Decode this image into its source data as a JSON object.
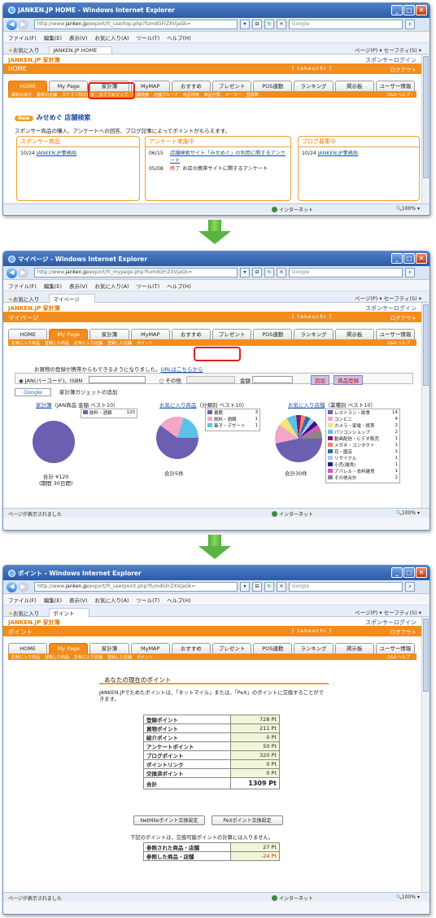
{
  "browser": {
    "app_suffix": " - Windows Internet Explorer",
    "menu": [
      "ファイル(F)",
      "編集(E)",
      "表示(V)",
      "お気に入り(A)",
      "ツール(T)",
      "ヘルプ(H)"
    ],
    "favorites_label": "お気に入り",
    "commands": "ページ(P) ▾  セーフティ(S) ▾",
    "search_placeholder": "Google",
    "status_zone": "インターネット",
    "zoom": "100%"
  },
  "site": {
    "name": "JANKEN.JP 家計簿",
    "sponsor_login": "スポンサーログイン",
    "user": "[ takeuchi ]",
    "logout": "ログアウト"
  },
  "nav": [
    "HOME",
    "My Page",
    "家計簿",
    "MyMAP",
    "おすすめ",
    "プレゼント",
    "POS連動",
    "ランキング",
    "掲示板",
    "ユーザー情報"
  ],
  "shot1": {
    "title": "JANKEN.JP HOME",
    "url_prefix": "http://www.",
    "url_domain": "janken.jp",
    "url_path": "/export/fr_usertop.php?fumdGFrZXVjaGk=",
    "tab": "JANKEN.JP HOME",
    "bar": "HOME",
    "subnav": [
      "最新の家計",
      "最新の店舗",
      "カテゴリ別の表示",
      "おすすめマップ",
      "店舗検索",
      "店舗グループ",
      "商品検索",
      "商品分類",
      "メーカー",
      "登録数"
    ],
    "subnav_right": "Q&A  ヘルプ",
    "new_badge": "New",
    "store_search": "みせめぐ 店舗検索",
    "intro": "スポンサー商品の購入、アンケートへの回答、ブログ記事によってポイントがもらえます。",
    "panels": [
      {
        "title": "スポンサー商品",
        "rows": [
          {
            "date": "10/24",
            "text": "JANKEN.JP事務局"
          }
        ]
      },
      {
        "title": "アンケート実施中",
        "rows": [
          {
            "date": "06/15",
            "text": "店舗検索サイト「みせめぐ」の利用に関するアンケート"
          },
          {
            "date": "05/08",
            "status": "終了",
            "text": "お店の携帯サイトに関するアンケート"
          }
        ]
      },
      {
        "title": "ブログ募集中",
        "rows": [
          {
            "date": "10/24",
            "text": "JANKEN.JP事務局"
          }
        ]
      }
    ],
    "status_text": ""
  },
  "shot2": {
    "title": "マイページ",
    "url_prefix": "http://www.",
    "url_domain": "janken.jp",
    "url_path": "/export/fr_mypage.php?fumdGFrZXVjaGk=",
    "tab": "マイページ",
    "bar": "マイページ",
    "subnav": [
      "お気に入り商品",
      "登録した商品",
      "お気に入り店舗",
      "登録した店舗",
      "ポイント"
    ],
    "subnav_right": "Q&A  ヘルプ",
    "mobile_note": "お買物の登録が携帯からもできるようになりました。",
    "mobile_link": "URLはこちらから",
    "radio1": "JAN(バーコード)、ISBN",
    "radio2": "その他",
    "amount_label": "金額",
    "add_button": "追加",
    "register_button": "商品登録",
    "gadget_text": "家計簿ガジェットの追加",
    "charts": [
      {
        "title_link": "家計簿",
        "title_rest": "（JAN商品 金額 ベスト10）",
        "legend": [
          {
            "label": "飲料・酒類",
            "value": "120",
            "color": "#6a5fb0"
          }
        ],
        "total": "合計 ¥120",
        "period": "(期間 30日間)"
      },
      {
        "title_link": "お気に入り商品",
        "title_rest": "（分類別 ベスト10）",
        "legend": [
          {
            "label": "書籍",
            "value": "3",
            "color": "#6a5fb0"
          },
          {
            "label": "飲料・酒類",
            "value": "1",
            "color": "#f4a6c8"
          },
          {
            "label": "菓子・デザート",
            "value": "1",
            "color": "#5ec2e8"
          }
        ],
        "total": "合計5件"
      },
      {
        "title_link": "お気に入り店舗",
        "title_rest": "（業種別 ベスト10）",
        "legend": [
          {
            "label": "レストラン・飲食",
            "value": "14",
            "color": "#6a5fb0"
          },
          {
            "label": "コンビニ",
            "value": "4",
            "color": "#f4a6c8"
          },
          {
            "label": "カメラ・家電・携帯",
            "value": "2",
            "color": "#f6e27a"
          },
          {
            "label": "パソコンショップ",
            "value": "2",
            "color": "#5ec2e8"
          },
          {
            "label": "動画配信・ビデオ販売",
            "value": "1",
            "color": "#7a1f6e"
          },
          {
            "label": "メガネ・コンタクト",
            "value": "1",
            "color": "#f08070"
          },
          {
            "label": "花・園芸",
            "value": "1",
            "color": "#1f6fb0"
          },
          {
            "label": "リサイクル",
            "value": "1",
            "color": "#b9c3f0"
          },
          {
            "label": "小売(雑貨)",
            "value": "1",
            "color": "#20207a"
          },
          {
            "label": "アパレル・衣料雑貨",
            "value": "1",
            "color": "#e84fc0"
          },
          {
            "label": "その他合計",
            "value": "2",
            "color": "#888888"
          }
        ],
        "total": "合計30件"
      }
    ],
    "status_text": "ページが表示されました"
  },
  "shot3": {
    "title": "ポイント",
    "url_prefix": "http://www.",
    "url_domain": "janken.jp",
    "url_path": "/export/fr_userpoint.php?fumdGFrZXVjaGk=",
    "tab": "ポイント",
    "bar": "ポイント",
    "subnav": [
      "お気に入り商品",
      "登録した商品",
      "お気に入り店舗",
      "登録した店舗",
      "ポイント"
    ],
    "subnav_right": "Q&A  ヘルプ",
    "heading": "あなたの現在のポイント",
    "desc": "JANKEN.JPでためたポイントは、「ネットマイル」または、「PeX」のポイントに交換することができます。",
    "points": [
      {
        "k": "登録ポイント",
        "v": "728 Pt"
      },
      {
        "k": "買物ポイント",
        "v": "211 Pt"
      },
      {
        "k": "紹介ポイント",
        "v": "0 Pt"
      },
      {
        "k": "アンケートポイント",
        "v": "50 Pt"
      },
      {
        "k": "ブログポイント",
        "v": "320 Pt"
      },
      {
        "k": "ポイントリンク",
        "v": "0 Pt"
      },
      {
        "k": "交換済ポイント",
        "v": "0 Pt"
      }
    ],
    "total_label": "合計",
    "total_value": "1309 Pt",
    "btn_netmile": "NetMileポイント交換設定",
    "btn_pex": "PeXポイント交換設定",
    "note": "下記のポイントは、交換可能ポイントの計算には入りません。",
    "extra": [
      {
        "k": "参照された商品・店舗",
        "v": "27 Pt"
      },
      {
        "k": "参照した商品・店舗",
        "v": "-24 Pt"
      }
    ],
    "status_text": "ページが表示されました"
  }
}
